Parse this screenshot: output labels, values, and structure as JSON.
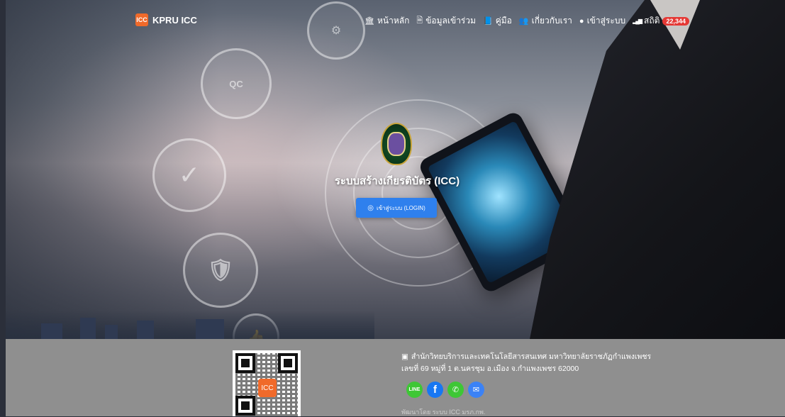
{
  "brand": {
    "name": "KPRU ICC",
    "logo_icon": "icc-app-logo",
    "logo_glyph": "ICC"
  },
  "nav": {
    "items": [
      {
        "label": "หน้าหลัก",
        "icon": "bank-icon",
        "glyph": "🏛"
      },
      {
        "label": "ข้อมูลเข้าร่วม",
        "icon": "document-icon",
        "glyph": "🗎"
      },
      {
        "label": "คู่มือ",
        "icon": "book-icon",
        "glyph": "📘"
      },
      {
        "label": "เกี่ยวกับเรา",
        "icon": "users-icon",
        "glyph": "👥"
      },
      {
        "label": "เข้าสู่ระบบ",
        "icon": "user-circle-icon",
        "glyph": "●"
      },
      {
        "label": "สถิติ",
        "icon": "signal-bars-icon",
        "glyph": "▂▄▆"
      }
    ],
    "stats_badge": "22,344"
  },
  "hero": {
    "title": "ระบบสร้างเกียรติบัตร (ICC)",
    "login_button": "เข้าสู่ระบบ (LOGIN)",
    "login_icon": "user-circle-icon",
    "qc_label": "QC"
  },
  "footer": {
    "address_line1": "สำนักวิทยบริการและเทคโนโลยีสารสนเทศ มหาวิทยาลัยราชภัฏกำแพงเพชร",
    "address_line2": "เลขที่ 69 หมู่ที่ 1 ต.นครชุม อ.เมือง จ.กำแพงเพชร 62000",
    "address_icon": "building-icon",
    "social": [
      {
        "name": "line-icon",
        "glyph": "LINE",
        "color": "#3ec735"
      },
      {
        "name": "facebook-icon",
        "glyph": "f",
        "color": "#1877f2"
      },
      {
        "name": "phone-icon",
        "glyph": "✆",
        "color": "#3ec735"
      },
      {
        "name": "email-icon",
        "glyph": "✉",
        "color": "#3b82f6"
      }
    ],
    "bottom_text": "พัฒนาโดย ระบบ ICC มรภ.กพ."
  },
  "colors": {
    "accent": "#2f80ed",
    "brand": "#f06a2a",
    "badge": "#e53935",
    "footer_bg": "#8f8f8f"
  }
}
